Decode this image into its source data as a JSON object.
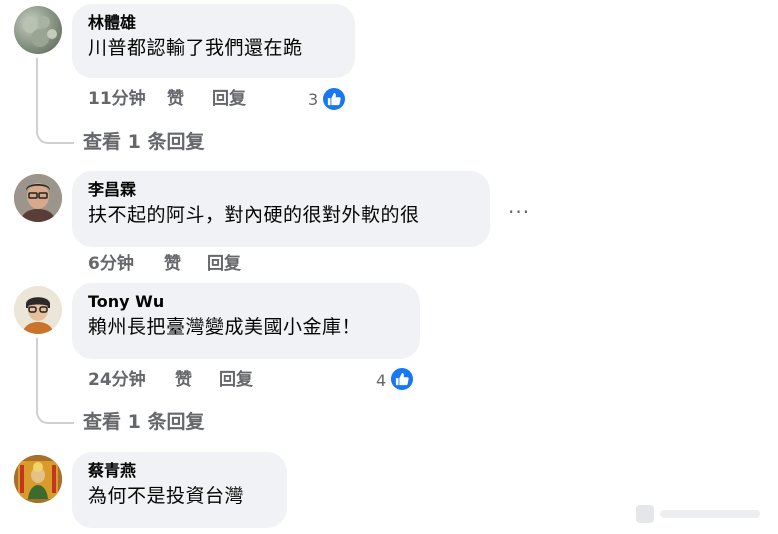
{
  "comments": [
    {
      "name": "林體雄",
      "text": "川普都認輸了我們還在跪",
      "time": "11分钟",
      "like_label": "赞",
      "reply_label": "回复",
      "reaction_count": "3",
      "view_replies": "查看 1 条回复"
    },
    {
      "name": "李昌霖",
      "text": "扶不起的阿斗，對內硬的很對外軟的很",
      "time": "6分钟",
      "like_label": "赞",
      "reply_label": "回复",
      "more": "···"
    },
    {
      "name": "Tony Wu",
      "text": "賴州長把臺灣變成美國小金庫！",
      "time": "24分钟",
      "like_label": "赞",
      "reply_label": "回复",
      "reaction_count": "4",
      "view_replies": "查看 1 条回复"
    },
    {
      "name": "蔡青燕",
      "text": "為何不是投資台灣"
    }
  ],
  "colors": {
    "bubble": "#f0f2f5",
    "meta": "#65676b",
    "like_blue": "#1877f2",
    "thread": "#ced0d4"
  },
  "icons": [
    "thumbs-up-icon",
    "more-options-icon",
    "avatar"
  ]
}
